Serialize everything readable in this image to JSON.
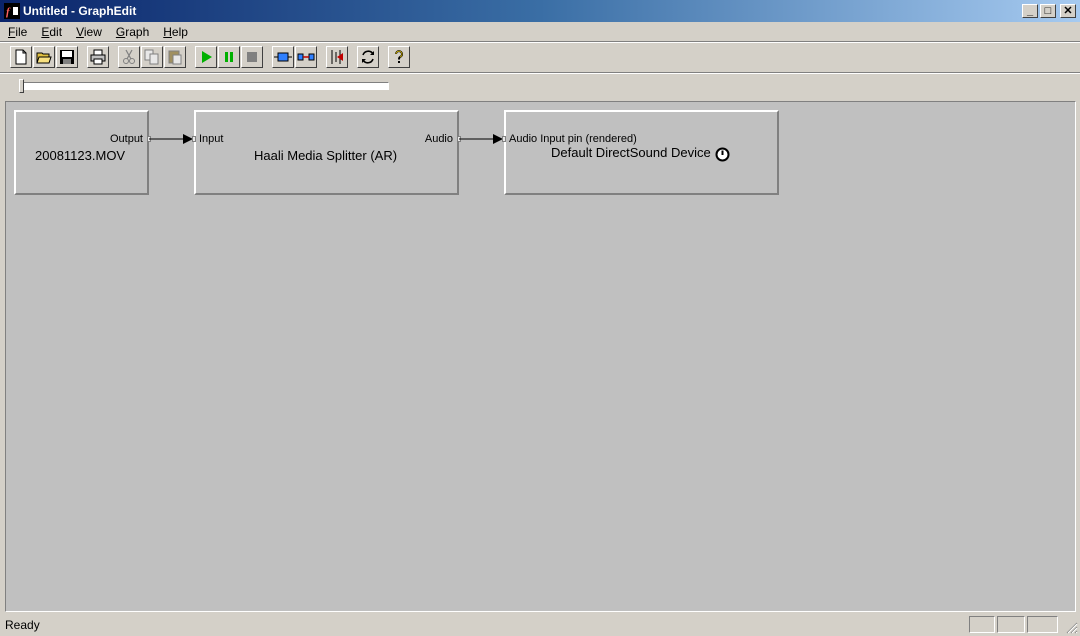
{
  "window": {
    "title": "Untitled - GraphEdit",
    "minimize_glyph": "_",
    "maximize_glyph": "□",
    "close_glyph": "✕"
  },
  "menu": [
    {
      "accel": "F",
      "rest": "ile"
    },
    {
      "accel": "E",
      "rest": "dit"
    },
    {
      "accel": "V",
      "rest": "iew"
    },
    {
      "accel": "G",
      "rest": "raph"
    },
    {
      "accel": "H",
      "rest": "elp"
    }
  ],
  "toolbar": {
    "icons": [
      "new-file-icon",
      "open-folder-icon",
      "save-icon",
      "print-icon",
      "cut-icon",
      "copy-icon",
      "paste-icon",
      "play-icon",
      "pause-icon",
      "stop-icon",
      "insert-filter-icon",
      "connect-pins-icon",
      "arrange-filters-icon",
      "refresh-icon",
      "help-icon"
    ]
  },
  "seek": {
    "position": 0
  },
  "filters": [
    {
      "name": "20081123.MOV",
      "out_pin": "Output"
    },
    {
      "name": "Haali Media Splitter (AR)",
      "in_pin": "Input",
      "out_pin": "Audio"
    },
    {
      "name": "Default DirectSound Device",
      "in_pin": "Audio Input pin (rendered)",
      "clock_icon": "clock-icon"
    }
  ],
  "status": {
    "text": "Ready"
  },
  "colors": {
    "title_start": "#0a246a",
    "title_end": "#a6caf0",
    "canvas": "#c0c0c0",
    "chrome": "#d4d0c8",
    "play": "#00b000",
    "pause": "#00b000"
  }
}
